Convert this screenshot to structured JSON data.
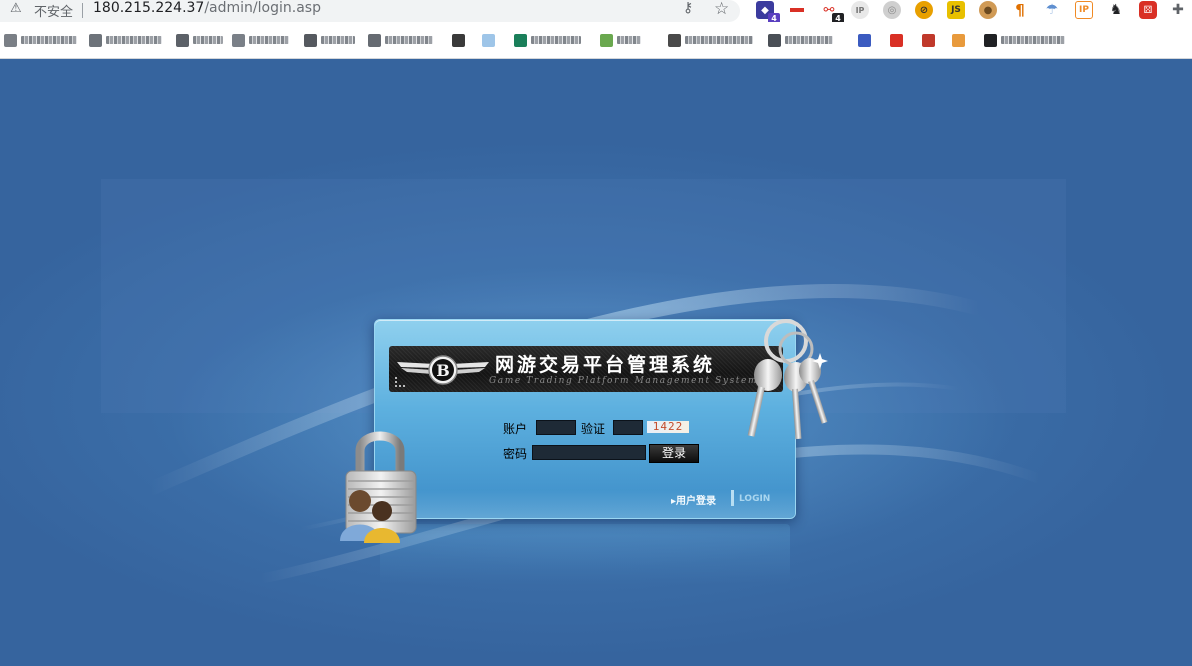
{
  "browser": {
    "warning_label": "不安全",
    "url_host": "180.215.224.37",
    "url_path": "/admin/login.asp",
    "icons": [
      "warning-icon",
      "key-icon",
      "star-icon"
    ],
    "extensions": [
      {
        "name": "ext-stack-icon",
        "badge": "4",
        "color": "#3b3b9e"
      },
      {
        "name": "ext-flag-icon",
        "badge": "",
        "color": "#d93025"
      },
      {
        "name": "ext-link-icon",
        "badge": "4",
        "color": "#d93025"
      },
      {
        "name": "ext-ip-icon",
        "badge": "",
        "color": "#8a8a8a"
      },
      {
        "name": "ext-globe-icon",
        "badge": "",
        "color": "#8a8a8a"
      },
      {
        "name": "ext-block-icon",
        "badge": "",
        "color": "#e8a000"
      },
      {
        "name": "ext-js-icon",
        "badge": "",
        "color": "#e8c000"
      },
      {
        "name": "ext-cookie-icon",
        "badge": "",
        "color": "#c8843a"
      },
      {
        "name": "ext-pilcrow-icon",
        "badge": "",
        "color": "#e07000"
      },
      {
        "name": "ext-cloud-icon",
        "badge": "",
        "color": "#5f8fd0"
      },
      {
        "name": "ext-ip-orange-icon",
        "badge": "",
        "color": "#f08a24"
      },
      {
        "name": "ext-evernote-icon",
        "badge": "",
        "color": "#202124"
      },
      {
        "name": "ext-dice-icon",
        "badge": "",
        "color": "#d93025"
      },
      {
        "name": "puzzle-icon",
        "badge": "",
        "color": "#5f6368"
      }
    ]
  },
  "login": {
    "title_cn": "网游交易平台管理系统",
    "title_en": "Game Trading Platform Management System",
    "account_label": "账户",
    "captcha_label": "验证",
    "password_label": "密码",
    "captcha_code": "1422",
    "login_button": "登录",
    "user_login_link": "▸用户登录",
    "login_en": "LOGIN"
  }
}
